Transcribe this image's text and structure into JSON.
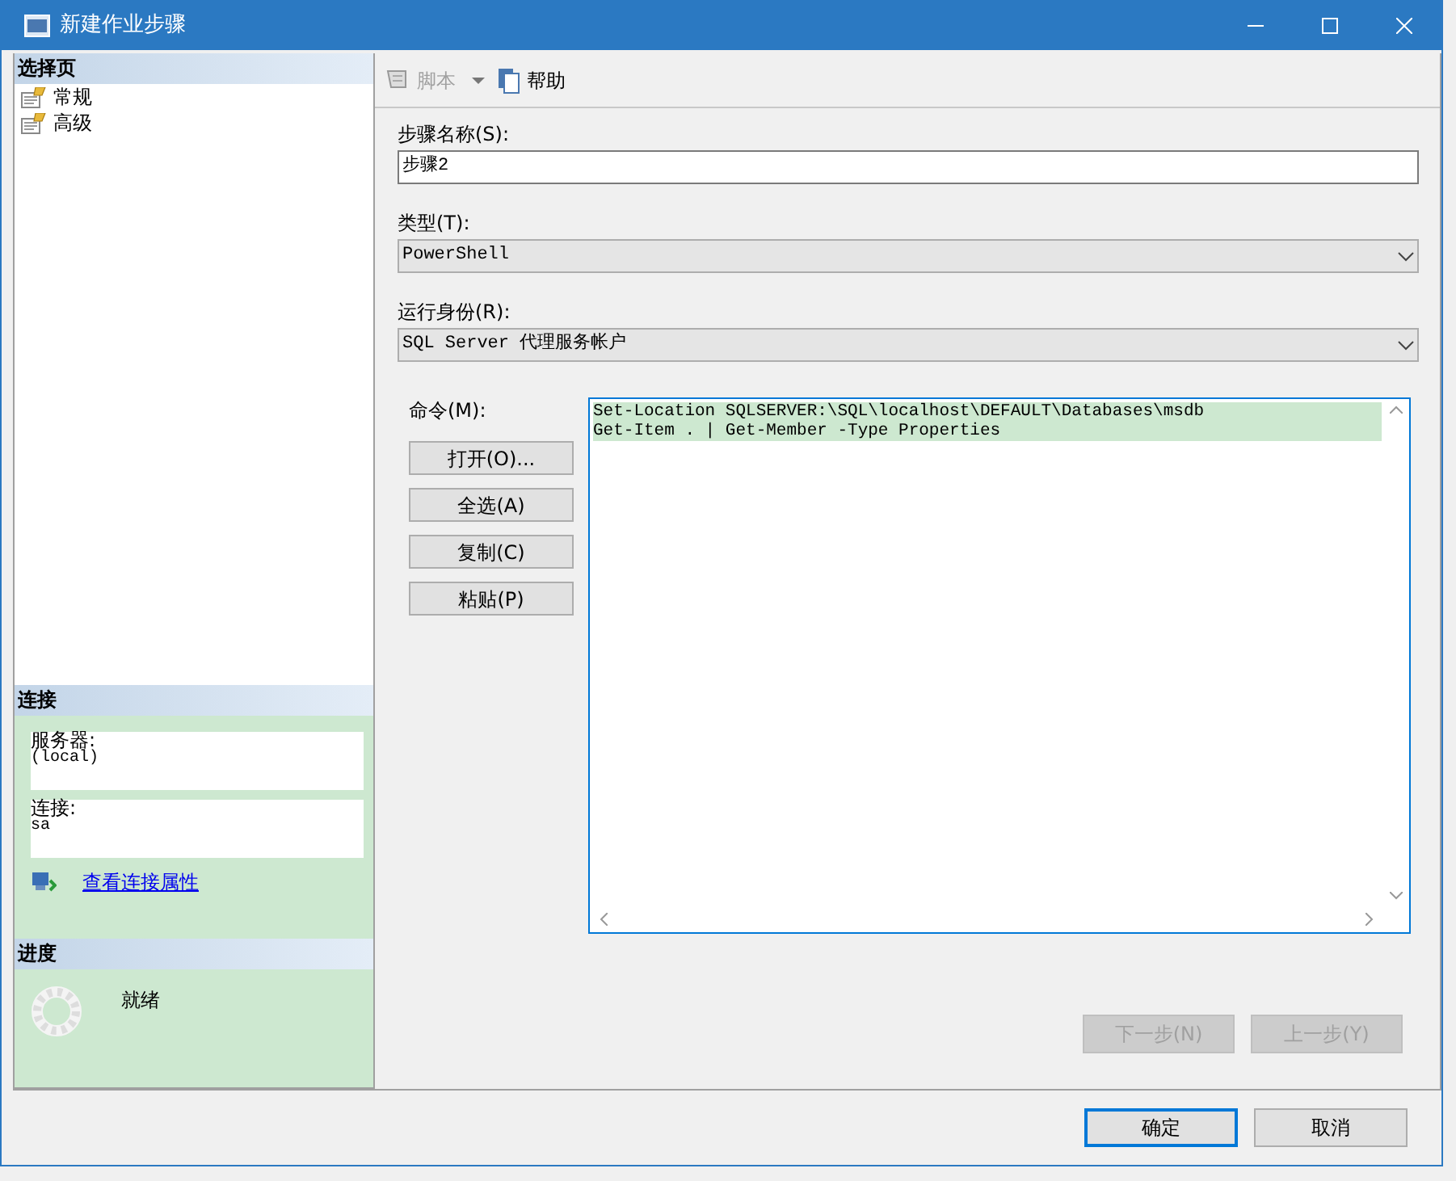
{
  "window": {
    "title": "新建作业步骤"
  },
  "sidebar": {
    "header": "选择页",
    "items": [
      {
        "label": "常规"
      },
      {
        "label": "高级"
      }
    ]
  },
  "connection": {
    "header": "连接",
    "fields": [
      {
        "label": "服务器:",
        "value": "(local)"
      },
      {
        "label": "连接:",
        "value": "sa"
      }
    ],
    "link": "查看连接属性"
  },
  "progress": {
    "header": "进度",
    "status": "就绪"
  },
  "toolbar": [
    {
      "kind": "script",
      "label": "脚本",
      "disabled": true
    },
    {
      "kind": "help",
      "label": "帮助",
      "disabled": false
    }
  ],
  "form": [
    {
      "kind": "text",
      "label": "步骤名称(S):",
      "value": "步骤2"
    },
    {
      "kind": "select",
      "label": "类型(T):",
      "value": "PowerShell"
    },
    {
      "kind": "select",
      "label": "运行身份(R):",
      "value": "SQL Server 代理服务帐户"
    }
  ],
  "command": {
    "label": "命令(M):",
    "buttons": [
      "打开(O)...",
      "全选(A)",
      "复制(C)",
      "粘贴(P)"
    ],
    "lines": [
      {
        "text": "Set-Location SQLSERVER:\\SQL\\localhost\\DEFAULT\\Databases\\msdb",
        "highlighted": true
      },
      {
        "text": "Get-Item . | Get-Member -Type Properties",
        "highlighted": true
      }
    ]
  },
  "nav_buttons": [
    {
      "label": "下一步(N)",
      "disabled": true
    },
    {
      "label": "上一步(Y)",
      "disabled": true
    }
  ],
  "buttons": [
    {
      "label": "确定",
      "default": true
    },
    {
      "label": "取消",
      "default": false
    }
  ]
}
